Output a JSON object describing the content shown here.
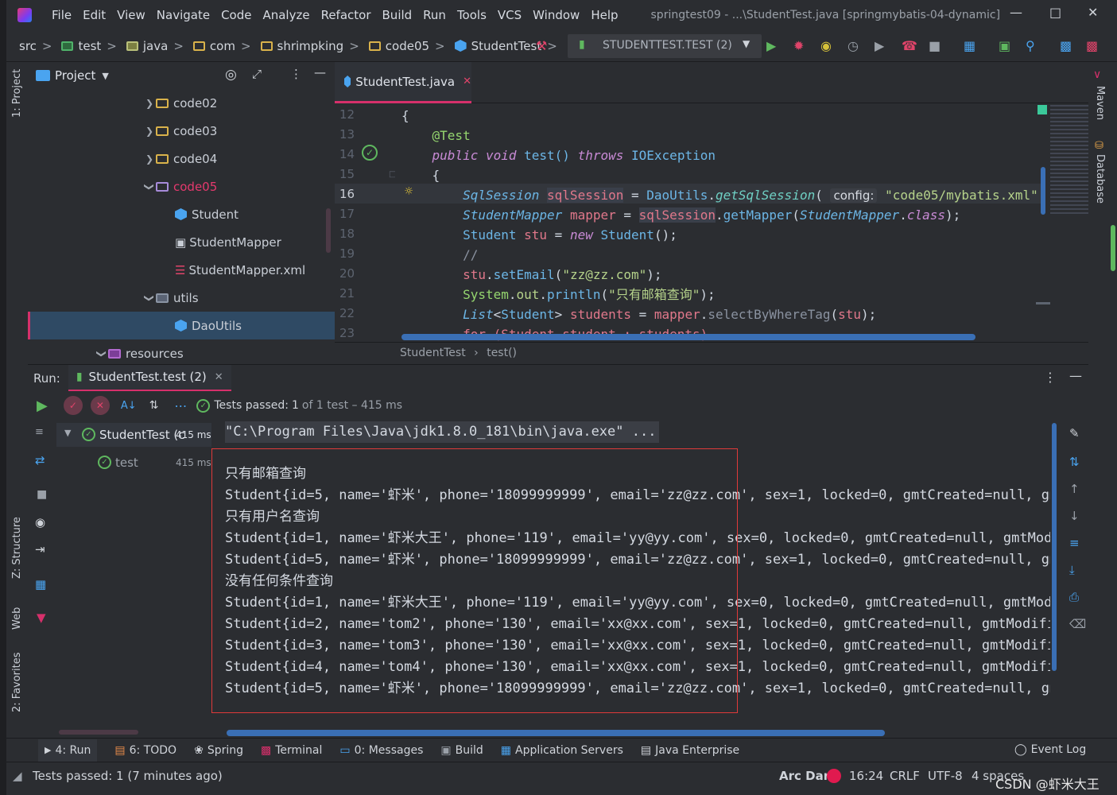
{
  "menubar": {
    "items": [
      "File",
      "Edit",
      "View",
      "Navigate",
      "Code",
      "Analyze",
      "Refactor",
      "Build",
      "Run",
      "Tools",
      "VCS",
      "Window",
      "Help"
    ],
    "window_title": "springtest09 - ...\\StudentTest.java [springmybatis-04-dynamic]"
  },
  "breadcrumb": [
    "src",
    "test",
    "java",
    "com",
    "shrimpking",
    "code05",
    "StudentTest"
  ],
  "run_config": "STUDENTTEST.TEST (2)",
  "left_strip": {
    "project": "1: Project",
    "structure": "Z: Structure",
    "web": "Web",
    "favorites": "2: Favorites"
  },
  "right_strip": {
    "maven": "Maven",
    "database": "Database"
  },
  "project_panel": {
    "title": "Project",
    "tree": [
      {
        "label": "code02",
        "type": "folder",
        "indent": 1,
        "expanded": false
      },
      {
        "label": "code03",
        "type": "folder",
        "indent": 1,
        "expanded": false
      },
      {
        "label": "code04",
        "type": "folder",
        "indent": 1,
        "expanded": false
      },
      {
        "label": "code05",
        "type": "folder",
        "indent": 1,
        "expanded": true,
        "highlight": true
      },
      {
        "label": "Student",
        "type": "class",
        "indent": 2
      },
      {
        "label": "StudentMapper",
        "type": "interface",
        "indent": 2
      },
      {
        "label": "StudentMapper.xml",
        "type": "xml",
        "indent": 2
      },
      {
        "label": "utils",
        "type": "package",
        "indent": 1,
        "expanded": true
      },
      {
        "label": "DaoUtils",
        "type": "class",
        "indent": 2,
        "selected": true
      },
      {
        "label": "resources",
        "type": "resources",
        "indent": 0,
        "expanded": true
      }
    ]
  },
  "editor": {
    "tab": "StudentTest.java",
    "line_numbers": [
      "12",
      "13",
      "14",
      "15",
      "16",
      "17",
      "18",
      "19",
      "20",
      "21",
      "22",
      "23"
    ],
    "current_line": "16",
    "crumbs": [
      "StudentTest",
      "test()"
    ],
    "code": {
      "l12": "{",
      "l13": "@Test",
      "l14a": "public",
      "l14b": "void",
      "l14c": "test()",
      "l14d": "throws",
      "l14e": "IOException",
      "l15": "{",
      "l16a": "SqlSession",
      "l16b": "sqlSession",
      "l16c": "=",
      "l16d": "DaoUtils",
      "l16e": "getSqlSession",
      "l16f": "config:",
      "l16g": "\"code05/mybatis.xml\"",
      "l17a": "StudentMapper",
      "l17b": "mapper",
      "l17c": "sqlSession",
      "l17d": "getMapper",
      "l17e": "StudentMapper",
      "l17f": "class",
      "l18a": "Student",
      "l18b": "stu",
      "l18c": "new",
      "l18d": "Student",
      "l19": "//",
      "l20a": "stu",
      "l20b": "setEmail",
      "l20c": "\"zz@zz.com\"",
      "l21a": "System",
      "l21b": "out",
      "l21c": "println",
      "l21d": "\"只有邮箱查询\"",
      "l22a": "List",
      "l22b": "Student",
      "l22c": "students",
      "l22d": "mapper",
      "l22e": "selectByWhereTag",
      "l22f": "stu",
      "l23": "for (Student student : students)"
    }
  },
  "run_panel": {
    "label": "Run:",
    "tab": "StudentTest.test (2)",
    "status_prefix": "Tests passed:",
    "status_count": "1",
    "status_suffix": "of 1 test – 415 ms",
    "tests": [
      {
        "name": "StudentTest (c",
        "time": "415 ms"
      },
      {
        "name": "test",
        "time": "415 ms"
      }
    ],
    "console": [
      "\"C:\\Program Files\\Java\\jdk1.8.0_181\\bin\\java.exe\" ...",
      "只有邮箱查询",
      "Student{id=5, name='虾米', phone='18099999999', email='zz@zz.com', sex=1, locked=0, gmtCreated=null, gmt",
      "只有用户名查询",
      "Student{id=1, name='虾米大王', phone='119', email='yy@yy.com', sex=0, locked=0, gmtCreated=null, gmtModif",
      "Student{id=5, name='虾米', phone='18099999999', email='zz@zz.com', sex=1, locked=0, gmtCreated=null, gmt",
      "没有任何条件查询",
      "Student{id=1, name='虾米大王', phone='119', email='yy@yy.com', sex=0, locked=0, gmtCreated=null, gmtModif",
      "Student{id=2, name='tom2', phone='130', email='xx@xx.com', sex=1, locked=0, gmtCreated=null, gmtModifiec",
      "Student{id=3, name='tom3', phone='130', email='xx@xx.com', sex=1, locked=0, gmtCreated=null, gmtModifiec",
      "Student{id=4, name='tom4', phone='130', email='xx@xx.com', sex=1, locked=0, gmtCreated=null, gmtModifiec",
      "Student{id=5, name='虾米', phone='18099999999', email='zz@zz.com', sex=1, locked=0, gmtCreated=null, gmt"
    ]
  },
  "bottom_tabs": [
    {
      "label": "4: Run",
      "icon": "play-icon"
    },
    {
      "label": "6: TODO",
      "icon": "todo-icon"
    },
    {
      "label": "Spring",
      "icon": "spring-icon"
    },
    {
      "label": "Terminal",
      "icon": "terminal-icon"
    },
    {
      "label": "0: Messages",
      "icon": "messages-icon"
    },
    {
      "label": "Build",
      "icon": "build-icon"
    },
    {
      "label": "Application Servers",
      "icon": "servers-icon"
    },
    {
      "label": "Java Enterprise",
      "icon": "enterprise-icon"
    }
  ],
  "event_log": "Event Log",
  "status": {
    "message": "Tests passed: 1 (7 minutes ago)",
    "theme": "Arc Dark",
    "position": "16:24",
    "line_sep": "CRLF",
    "encoding": "UTF-8",
    "indent": "4 spaces",
    "watermark": "CSDN @虾米大王"
  },
  "colors": {
    "accent": "#d6306b",
    "pass": "#5fb85f",
    "selection": "#2f4a64",
    "redbox": "#e03a3a"
  }
}
